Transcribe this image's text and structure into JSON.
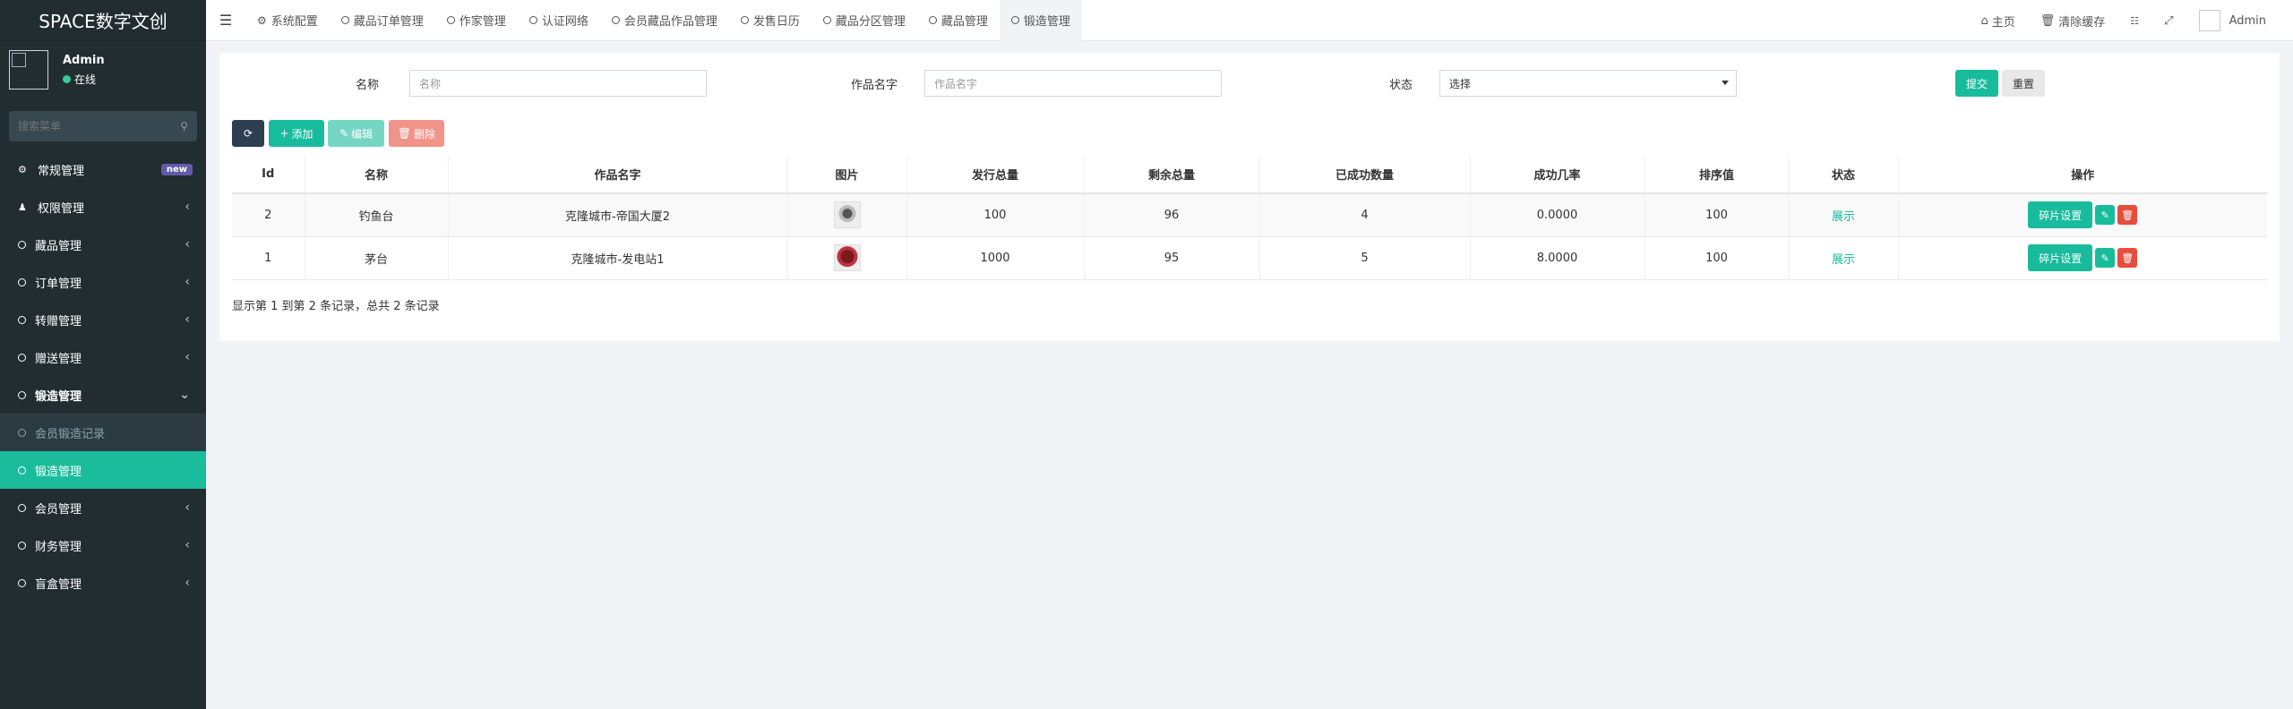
{
  "app": {
    "title": "SPACE数字文创"
  },
  "user": {
    "name": "Admin",
    "status": "在线"
  },
  "sidebar": {
    "search_placeholder": "搜索菜单",
    "items": [
      {
        "label": "常规管理",
        "icon": "cogs-icon",
        "badge": "new"
      },
      {
        "label": "权限管理",
        "icon": "group-icon"
      },
      {
        "label": "藏品管理",
        "icon": "circle-icon"
      },
      {
        "label": "订单管理",
        "icon": "circle-icon"
      },
      {
        "label": "转赠管理",
        "icon": "circle-icon"
      },
      {
        "label": "赠送管理",
        "icon": "circle-icon"
      },
      {
        "label": "锻造管理",
        "icon": "circle-icon",
        "open": true
      },
      {
        "label": "会员锻造记录",
        "icon": "circle-icon",
        "sub": true
      },
      {
        "label": "锻造管理",
        "icon": "circle-icon",
        "sub": true,
        "active": true
      },
      {
        "label": "会员管理",
        "icon": "circle-icon"
      },
      {
        "label": "财务管理",
        "icon": "circle-icon"
      },
      {
        "label": "盲盒管理",
        "icon": "circle-icon"
      }
    ]
  },
  "topbar": {
    "tabs": [
      {
        "label": "系统配置",
        "icon": "gear-icon"
      },
      {
        "label": "藏品订单管理",
        "icon": "circle-icon"
      },
      {
        "label": "作家管理",
        "icon": "circle-icon"
      },
      {
        "label": "认证网络",
        "icon": "circle-icon"
      },
      {
        "label": "会员藏品作品管理",
        "icon": "circle-icon"
      },
      {
        "label": "发售日历",
        "icon": "circle-icon"
      },
      {
        "label": "藏品分区管理",
        "icon": "circle-icon"
      },
      {
        "label": "藏品管理",
        "icon": "circle-icon"
      },
      {
        "label": "锻造管理",
        "icon": "circle-icon",
        "active": true
      }
    ],
    "home": "主页",
    "clear_cache": "清除缓存",
    "admin": "Admin"
  },
  "filters": {
    "name_label": "名称",
    "name_placeholder": "名称",
    "work_label": "作品名字",
    "work_placeholder": "作品名字",
    "status_label": "状态",
    "status_value": "选择",
    "submit": "提交",
    "reset": "重置"
  },
  "toolbar": {
    "add": "添加",
    "edit": "编辑",
    "delete": "删除"
  },
  "table": {
    "columns": [
      "Id",
      "名称",
      "作品名字",
      "图片",
      "发行总量",
      "剩余总量",
      "已成功数量",
      "成功几率",
      "排序值",
      "状态",
      "操作"
    ],
    "rows": [
      {
        "id": "2",
        "name": "钓鱼台",
        "work": "克隆城市-帝国大厦2",
        "issued": "100",
        "remaining": "96",
        "success": "4",
        "rate": "0.0000",
        "sort": "100",
        "status": "展示",
        "op": "碎片设置"
      },
      {
        "id": "1",
        "name": "茅台",
        "work": "克隆城市-发电站1",
        "issued": "1000",
        "remaining": "95",
        "success": "5",
        "rate": "8.0000",
        "sort": "100",
        "status": "展示",
        "op": "碎片设置"
      }
    ]
  },
  "pagination": {
    "info": "显示第 1 到第 2 条记录，总共 2 条记录"
  }
}
